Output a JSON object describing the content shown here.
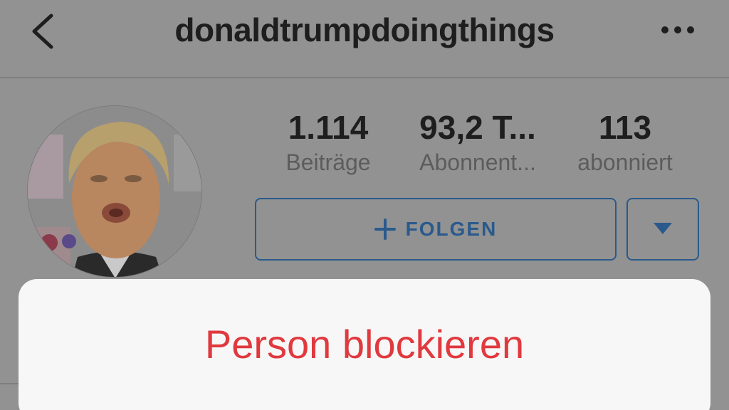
{
  "header": {
    "title": "donaldtrumpdoingthings",
    "back_icon": "chevron-left-icon",
    "more_icon": "more-horizontal-icon"
  },
  "profile": {
    "avatar_alt": "profile-photo",
    "stats": [
      {
        "value": "1.114",
        "label": "Beiträge"
      },
      {
        "value": "93,2 T...",
        "label": "Abonnent..."
      },
      {
        "value": "113",
        "label": "abonniert"
      }
    ],
    "follow_button": {
      "label": "FOLGEN",
      "icon": "plus-icon"
    },
    "dropdown_icon": "triangle-down-icon"
  },
  "action_sheet": {
    "actions": [
      {
        "label": "Person blockieren",
        "style": "destructive"
      }
    ]
  },
  "colors": {
    "overlay_background": "#929292",
    "accent": "#2a5a8c",
    "destructive": "#e0393e",
    "sheet_background": "#f7f7f7"
  }
}
